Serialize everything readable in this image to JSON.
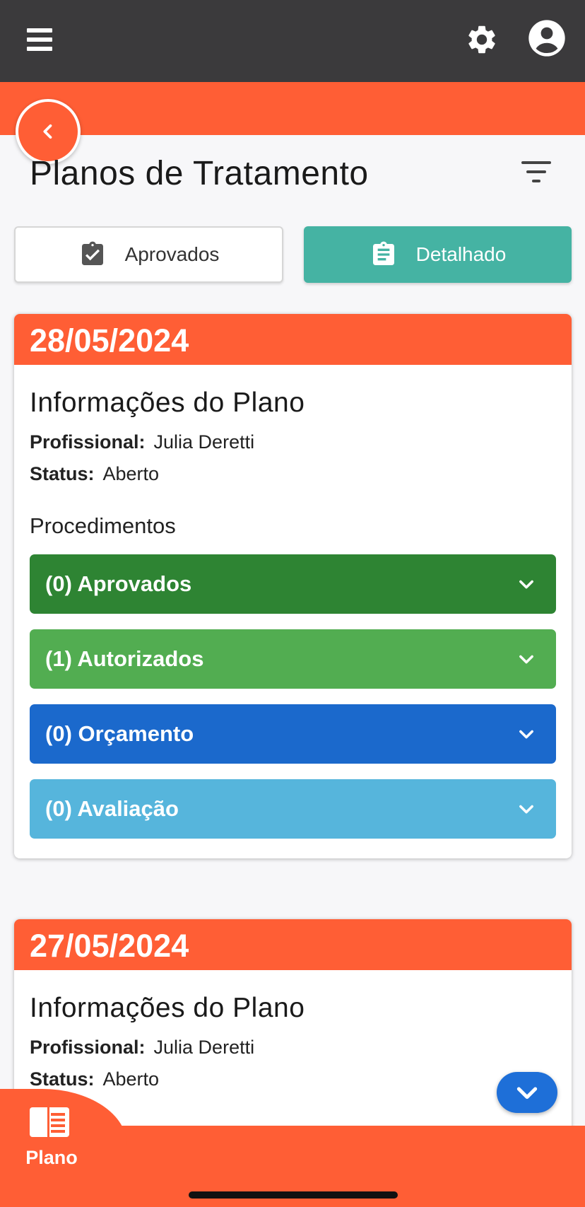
{
  "header": {
    "menu_icon": "hamburger-menu-icon",
    "settings_icon": "gear-icon",
    "account_icon": "account-circle-icon"
  },
  "page": {
    "title": "Planos de Tratamento",
    "back_icon": "chevron-left-icon",
    "filter_icon": "filter-list-icon"
  },
  "segments": [
    {
      "label": "Aprovados",
      "icon": "clipboard-check-icon",
      "active": false
    },
    {
      "label": "Detalhado",
      "icon": "clipboard-list-icon",
      "active": true
    }
  ],
  "plans": [
    {
      "date": "28/05/2024",
      "info_title": "Informações do Plano",
      "profissional_label": "Profissional:",
      "profissional": "Julia Deretti",
      "status_label": "Status:",
      "status": "Aberto",
      "procedimentos_label": "Procedimentos",
      "groups": [
        {
          "label": "(0) Aprovados",
          "color": "#2e8433"
        },
        {
          "label": "(1) Autorizados",
          "color": "#52ad51"
        },
        {
          "label": "(0) Orçamento",
          "color": "#1b69cc"
        },
        {
          "label": "(0) Avaliação",
          "color": "#56b5dc"
        }
      ]
    },
    {
      "date": "27/05/2024",
      "info_title": "Informações do Plano",
      "profissional_label": "Profissional:",
      "profissional": "Julia Deretti",
      "status_label": "Status:",
      "status": "Aberto"
    }
  ],
  "bottom_nav": {
    "tab_label": "Plano",
    "tab_icon": "plan-book-icon"
  },
  "colors": {
    "accent": "#ff5e35",
    "header": "#3b3a3c",
    "teal": "#45b3a3",
    "fab": "#1e6fd8"
  }
}
